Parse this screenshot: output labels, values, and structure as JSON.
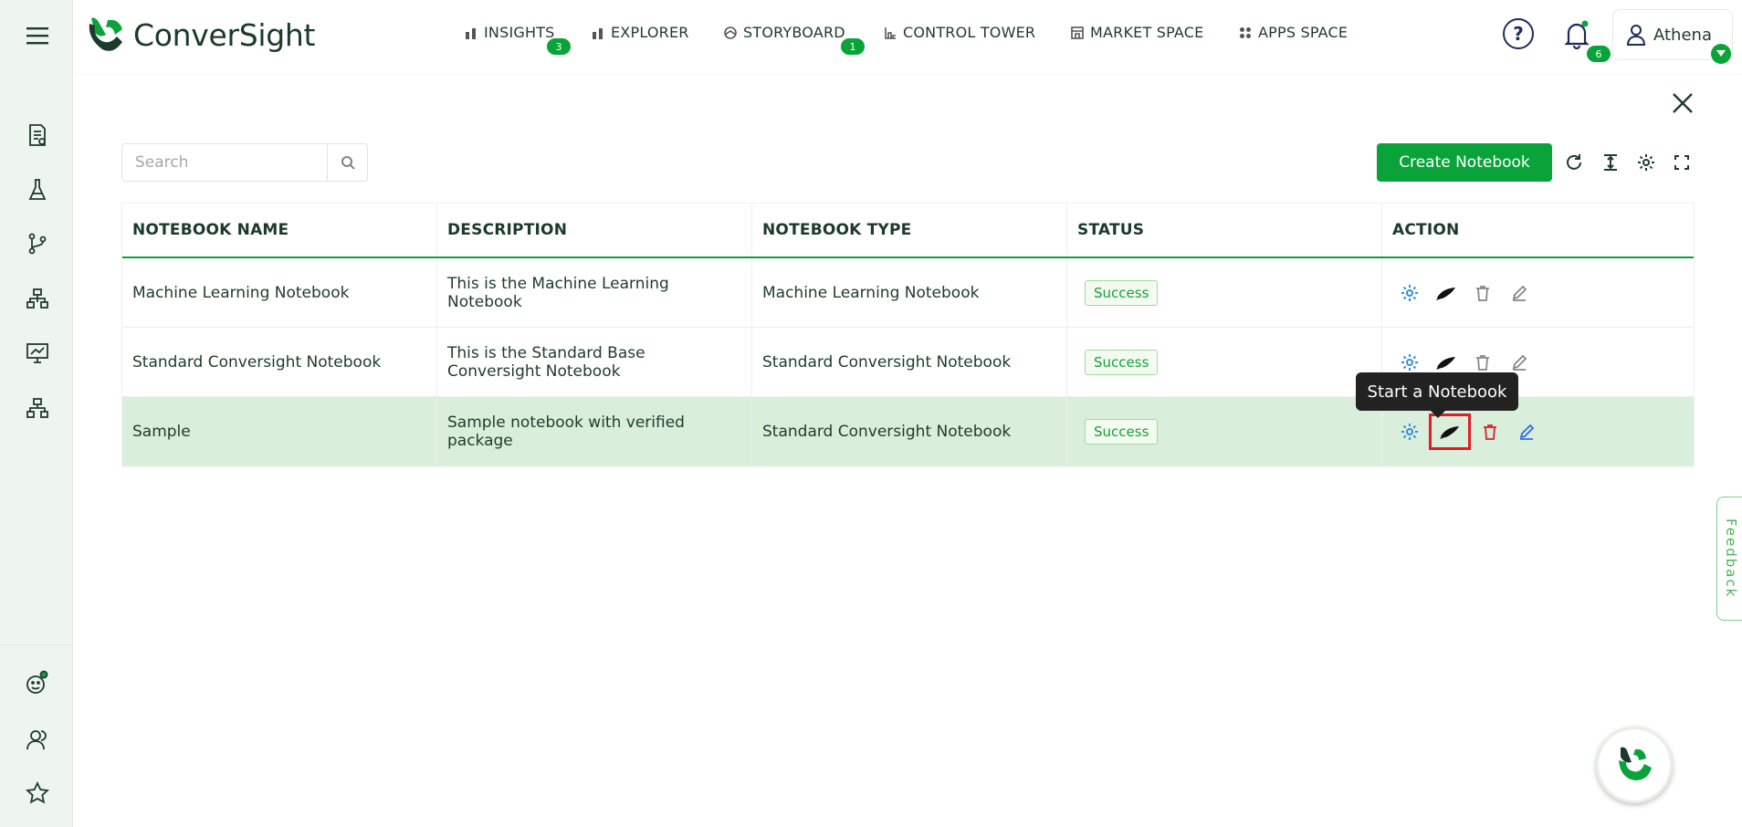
{
  "app": {
    "logo_text": "ConverSight",
    "brand_color": "#0aa33a"
  },
  "nav": [
    {
      "label": "INSIGHTS",
      "icon": "bar-chart-icon",
      "badge": "3"
    },
    {
      "label": "EXPLORER",
      "icon": "bar-chart-icon"
    },
    {
      "label": "STORYBOARD",
      "icon": "storyboard-icon",
      "badge": "1"
    },
    {
      "label": "CONTROL TOWER",
      "icon": "control-tower-icon"
    },
    {
      "label": "MARKET SPACE",
      "icon": "market-space-icon"
    },
    {
      "label": "APPS SPACE",
      "icon": "apps-grid-icon"
    }
  ],
  "header": {
    "help_label": "?",
    "notification_count": "6",
    "user_name": "Athena"
  },
  "search": {
    "placeholder": "Search"
  },
  "toolbar": {
    "create_label": "Create Notebook"
  },
  "table": {
    "columns": [
      "NOTEBOOK NAME",
      "DESCRIPTION",
      "NOTEBOOK TYPE",
      "STATUS",
      "ACTION"
    ],
    "rows": [
      {
        "name": "Machine Learning Notebook",
        "description": "This is the Machine Learning Notebook",
        "type": "Machine Learning Notebook",
        "status": "Success"
      },
      {
        "name": "Standard Conversight Notebook",
        "description": "This is the Standard Base Conversight Notebook",
        "type": "Standard Conversight Notebook",
        "status": "Success"
      },
      {
        "name": "Sample",
        "description": "Sample notebook with verified package",
        "type": "Standard Conversight Notebook",
        "status": "Success"
      }
    ]
  },
  "tooltip": {
    "text": "Start a Notebook"
  },
  "feedback": {
    "label": "Feedback"
  }
}
